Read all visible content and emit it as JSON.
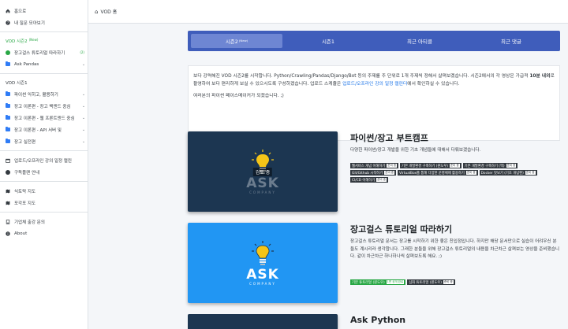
{
  "sidebar": {
    "home": "홈으로",
    "my_questions": "내 질문 모아보기",
    "vod2_title": "VOD 시즌2",
    "vod2_tag": "(New)",
    "vod2_items": [
      {
        "label": "장고걸스 튜토리얼 따라하기",
        "badge": "(2)"
      },
      {
        "label": "Ask Pandas"
      }
    ],
    "vod1_title": "VOD 시즌1",
    "vod1_items": [
      {
        "label": "파이썬 익히고, 활용하기"
      },
      {
        "label": "장고 이론편 - 장고 백엔드 중심"
      },
      {
        "label": "장고 이론편 - 웹 프론트엔드 중심"
      },
      {
        "label": "장고 이론편 - API 서버 및"
      },
      {
        "label": "장고 실전편"
      }
    ],
    "misc_items": [
      {
        "label": "업로드/오프라인 강의 일정 캘린"
      },
      {
        "label": "구독플랜 안내"
      }
    ],
    "map_items": [
      {
        "label": "식토락 지도"
      },
      {
        "label": "포각포 지도"
      }
    ],
    "bottom_items": [
      {
        "label": "기업체 출강 문의"
      },
      {
        "label": "About"
      }
    ]
  },
  "topbar": {
    "breadcrumb": "VOD 홈"
  },
  "tabs": [
    {
      "label": "시즌2",
      "sup": "(New)"
    },
    {
      "label": "시즌1"
    },
    {
      "label": "최근 아티클"
    },
    {
      "label": "최근 댓글"
    }
  ],
  "intro": {
    "line1": "보다 강력해진 VOD 시즌2를 시작합니다. Python/Crawling/Pandas/Django/Bot 등의 주제를 주 단위로 1개 주제씩 정해서 살펴보겠습니다. 시즌2에서의 각 영상은 가급적 ",
    "bold": "10분 내외",
    "line2": "로 촬영하여 보다 편리하게 보실 수 있으시도록 구성하겠습니다. 업로드 스케쥴은 ",
    "link": "업로드/오프라인 강의 일정 캘린더",
    "line3": "에서 확인하실 수 있습니다.",
    "line4": "여러분의 파이썬 페이스메이커가 되겠습니다. ;)"
  },
  "courses": [
    {
      "title": "파이썬/장고 부트캠프",
      "desc": "다양한 파이썬/장고 개발을 위한 기초 개념들에 대해서 다뤄보겠습니다.",
      "thumb_badge": "검토 중",
      "brand": "ASK",
      "brand_sub": "COMPANY",
      "tags": [
        {
          "label": "웹서비스 개념 이해하기",
          "cnt": "준비 중"
        },
        {
          "label": "기본 개발환경 구축하기 (윈도우)",
          "cnt": "준비 중"
        },
        {
          "label": "기본 개발환경 구축하기 (맥)",
          "cnt": "준비 중"
        },
        {
          "label": "Git/Github 시작하기",
          "cnt": "준비 중"
        },
        {
          "label": "VirtualBox를 통해 다양한 운영체제 활용하기",
          "cnt": "준비 중"
        },
        {
          "label": "Docker 맛보기 (기초 개념편)",
          "cnt": "준비 중"
        },
        {
          "label": "CI/CD 이해하기",
          "cnt": "준비 중"
        }
      ]
    },
    {
      "title": "장고걸스 튜토리얼 따라하기",
      "desc": "장고걸스 튜토리얼 문서는 장고를 시작하기 위한 좋은 친입점입니다. 하지만 해당 문서만으로 실습이 어려우신 분들도 계시리라 생각합니다. 그래한 분들을 위해 장고걸스 튜토리얼의 내용을 차근차근 살펴보는 영상을 준비했습니다. 같이 차근차근 하나하나씩 살펴보도록 해요. ;)",
      "brand": "ASK",
      "brand_sub": "COMPANY",
      "tags": [
        {
          "label": "기본 튜토리얼 (윈도우)",
          "cnt": "1편 공개 완료",
          "green": true
        },
        {
          "label": "심화 튜토리얼 (윈도우)",
          "cnt": "준비 중"
        }
      ]
    },
    {
      "title": "Ask Python"
    }
  ],
  "colors": {
    "tab_bar": "#3f5dbb",
    "tab_active": "#6e86d3",
    "link": "#1a73e8",
    "green": "#28a745",
    "folder": "#2f7cf6"
  }
}
